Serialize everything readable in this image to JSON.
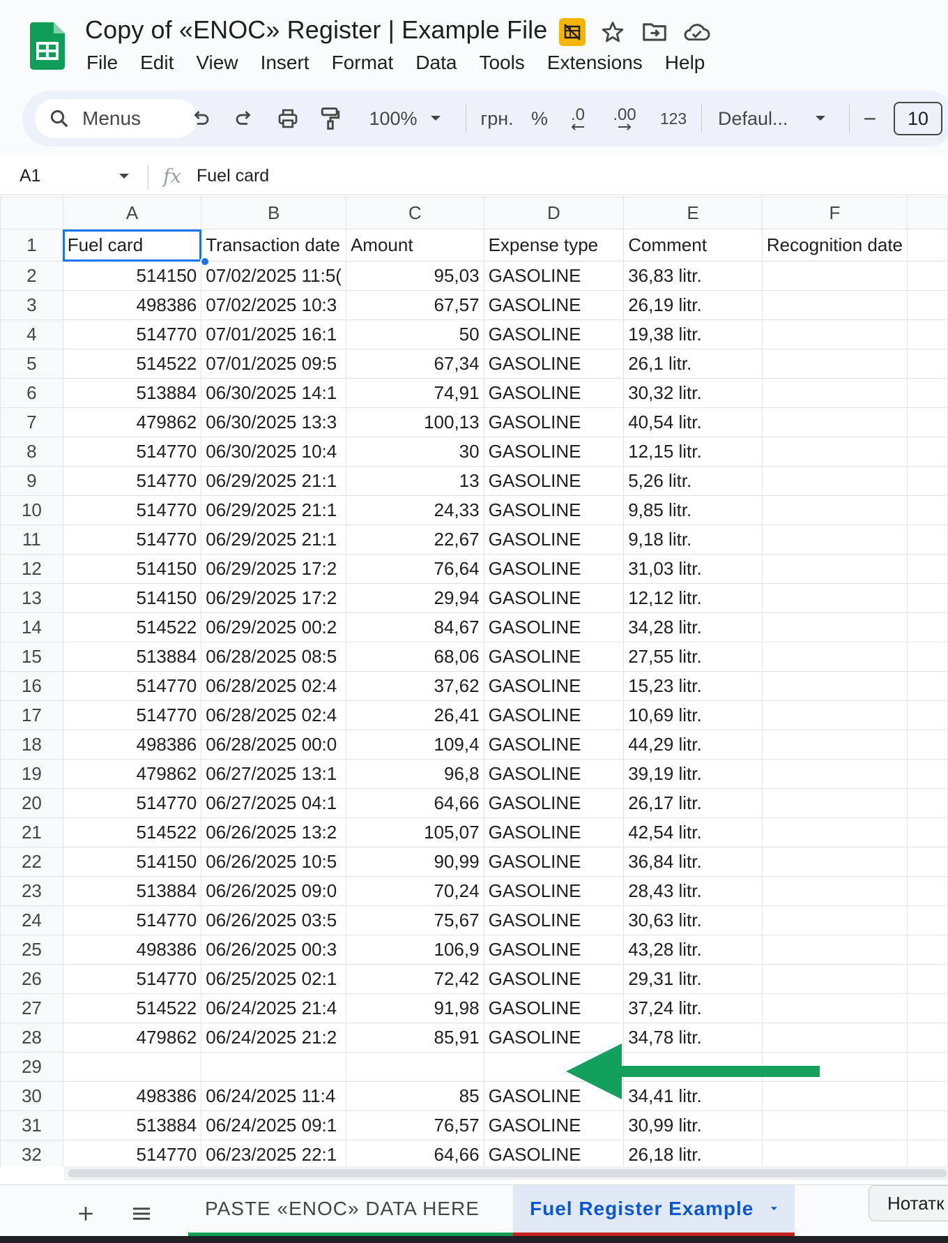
{
  "app": {
    "title": "Copy of «ENOC» Register | Example File",
    "menu": [
      "File",
      "Edit",
      "View",
      "Insert",
      "Format",
      "Data",
      "Tools",
      "Extensions",
      "Help"
    ]
  },
  "toolbar": {
    "search_label": "Menus",
    "zoom": "100%",
    "currency": "грн.",
    "percent": "%",
    "decrease_decimal": ".0",
    "increase_decimal": ".00",
    "number_format": "123",
    "font": "Defaul...",
    "font_size": "10",
    "minus": "−"
  },
  "formula_bar": {
    "cell_ref": "A1",
    "fx": "fx",
    "value": "Fuel card"
  },
  "sheet": {
    "columns": [
      "A",
      "B",
      "C",
      "D",
      "E",
      "F"
    ],
    "header": [
      "Fuel card",
      "Transaction date",
      "Amount",
      "Expense type",
      "Comment",
      "Recognition date"
    ],
    "rows": [
      {
        "n": "2",
        "a": "514150",
        "b": "07/02/2025 11:5(",
        "c": "95,03",
        "d": "GASOLINE",
        "e": "36,83 litr."
      },
      {
        "n": "3",
        "a": "498386",
        "b": "07/02/2025 10:3",
        "c": "67,57",
        "d": "GASOLINE",
        "e": "26,19 litr."
      },
      {
        "n": "4",
        "a": "514770",
        "b": "07/01/2025 16:1",
        "c": "50",
        "d": "GASOLINE",
        "e": "19,38 litr."
      },
      {
        "n": "5",
        "a": "514522",
        "b": "07/01/2025 09:5",
        "c": "67,34",
        "d": "GASOLINE",
        "e": "26,1 litr."
      },
      {
        "n": "6",
        "a": "513884",
        "b": "06/30/2025 14:1",
        "c": "74,91",
        "d": "GASOLINE",
        "e": "30,32 litr."
      },
      {
        "n": "7",
        "a": "479862",
        "b": "06/30/2025 13:3",
        "c": "100,13",
        "d": "GASOLINE",
        "e": "40,54 litr."
      },
      {
        "n": "8",
        "a": "514770",
        "b": "06/30/2025 10:4",
        "c": "30",
        "d": "GASOLINE",
        "e": "12,15 litr."
      },
      {
        "n": "9",
        "a": "514770",
        "b": "06/29/2025 21:1",
        "c": "13",
        "d": "GASOLINE",
        "e": "5,26 litr."
      },
      {
        "n": "10",
        "a": "514770",
        "b": "06/29/2025 21:1",
        "c": "24,33",
        "d": "GASOLINE",
        "e": "9,85 litr."
      },
      {
        "n": "11",
        "a": "514770",
        "b": "06/29/2025 21:1",
        "c": "22,67",
        "d": "GASOLINE",
        "e": "9,18 litr."
      },
      {
        "n": "12",
        "a": "514150",
        "b": "06/29/2025 17:2",
        "c": "76,64",
        "d": "GASOLINE",
        "e": "31,03 litr."
      },
      {
        "n": "13",
        "a": "514150",
        "b": "06/29/2025 17:2",
        "c": "29,94",
        "d": "GASOLINE",
        "e": "12,12 litr."
      },
      {
        "n": "14",
        "a": "514522",
        "b": "06/29/2025 00:2",
        "c": "84,67",
        "d": "GASOLINE",
        "e": "34,28 litr."
      },
      {
        "n": "15",
        "a": "513884",
        "b": "06/28/2025 08:5",
        "c": "68,06",
        "d": "GASOLINE",
        "e": "27,55 litr."
      },
      {
        "n": "16",
        "a": "514770",
        "b": "06/28/2025 02:4",
        "c": "37,62",
        "d": "GASOLINE",
        "e": "15,23 litr."
      },
      {
        "n": "17",
        "a": "514770",
        "b": "06/28/2025 02:4",
        "c": "26,41",
        "d": "GASOLINE",
        "e": "10,69 litr."
      },
      {
        "n": "18",
        "a": "498386",
        "b": "06/28/2025 00:0",
        "c": "109,4",
        "d": "GASOLINE",
        "e": "44,29 litr."
      },
      {
        "n": "19",
        "a": "479862",
        "b": "06/27/2025 13:1",
        "c": "96,8",
        "d": "GASOLINE",
        "e": "39,19 litr."
      },
      {
        "n": "20",
        "a": "514770",
        "b": "06/27/2025 04:1",
        "c": "64,66",
        "d": "GASOLINE",
        "e": "26,17 litr."
      },
      {
        "n": "21",
        "a": "514522",
        "b": "06/26/2025 13:2",
        "c": "105,07",
        "d": "GASOLINE",
        "e": "42,54 litr."
      },
      {
        "n": "22",
        "a": "514150",
        "b": "06/26/2025 10:5",
        "c": "90,99",
        "d": "GASOLINE",
        "e": "36,84 litr."
      },
      {
        "n": "23",
        "a": "513884",
        "b": "06/26/2025 09:0",
        "c": "70,24",
        "d": "GASOLINE",
        "e": "28,43 litr."
      },
      {
        "n": "24",
        "a": "514770",
        "b": "06/26/2025 03:5",
        "c": "75,67",
        "d": "GASOLINE",
        "e": "30,63 litr."
      },
      {
        "n": "25",
        "a": "498386",
        "b": "06/26/2025 00:3",
        "c": "106,9",
        "d": "GASOLINE",
        "e": "43,28 litr."
      },
      {
        "n": "26",
        "a": "514770",
        "b": "06/25/2025 02:1",
        "c": "72,42",
        "d": "GASOLINE",
        "e": "29,31 litr."
      },
      {
        "n": "27",
        "a": "514522",
        "b": "06/24/2025 21:4",
        "c": "91,98",
        "d": "GASOLINE",
        "e": "37,24 litr."
      },
      {
        "n": "28",
        "a": "479862",
        "b": "06/24/2025 21:2",
        "c": "85,91",
        "d": "GASOLINE",
        "e": "34,78 litr."
      },
      {
        "n": "29",
        "a": "",
        "b": "",
        "c": "",
        "d": "",
        "e": ""
      },
      {
        "n": "30",
        "a": "498386",
        "b": "06/24/2025 11:4",
        "c": "85",
        "d": "GASOLINE",
        "e": "34,41 litr."
      },
      {
        "n": "31",
        "a": "513884",
        "b": "06/24/2025 09:1",
        "c": "76,57",
        "d": "GASOLINE",
        "e": "30,99 litr."
      },
      {
        "n": "32",
        "a": "514770",
        "b": "06/23/2025 22:1",
        "c": "64,66",
        "d": "GASOLINE",
        "e": "26,18 litr."
      }
    ]
  },
  "tabs": {
    "sheets": [
      "PASTE «ENOC» DATA HERE",
      "Fuel Register Example"
    ],
    "active": "Fuel Register Example",
    "notes_chip": "Нотатк"
  },
  "colors": {
    "sheets_green": "#0f9d58",
    "selection_blue": "#1a73e8",
    "active_tab_blue": "#0b57d0",
    "arrow_green": "#12a05c",
    "hide_icon_bg": "#f4b400"
  },
  "icons": [
    "sheets-logo-icon",
    "hide-chart-icon",
    "star-icon",
    "move-folder-icon",
    "cloud-saved-icon",
    "search-icon",
    "undo-icon",
    "redo-icon",
    "print-icon",
    "paint-format-icon",
    "caret-down-icon",
    "add-sheet-icon",
    "all-sheets-icon",
    "annotation-arrow-icon"
  ]
}
